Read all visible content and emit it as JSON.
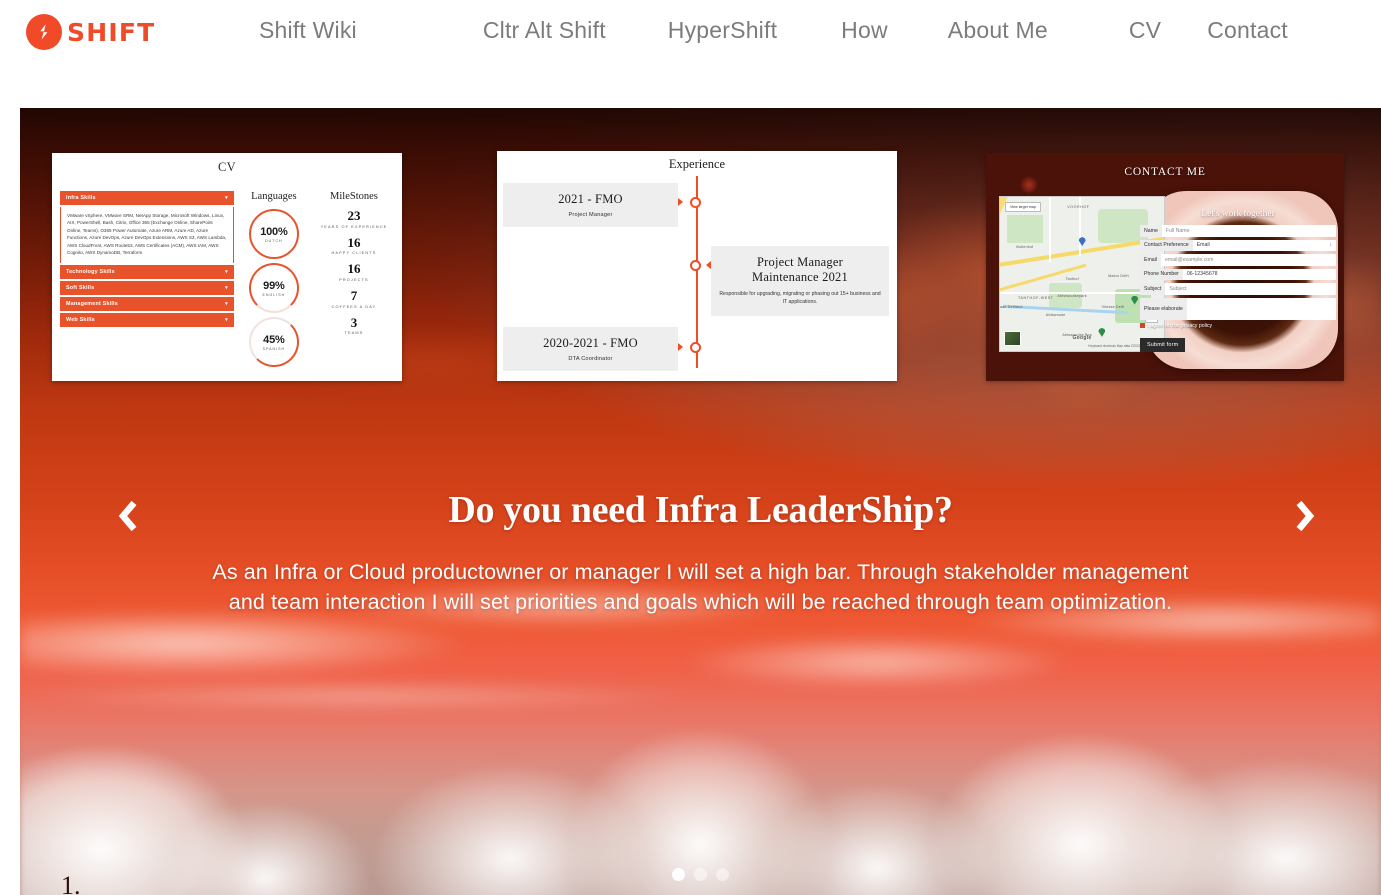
{
  "nav": {
    "logo_text": "SHIFT",
    "logo_icon": "shift-bolt-logo-icon",
    "items": [
      {
        "label": "Shift Wiki"
      },
      {
        "label": "Cltr Alt Shift"
      },
      {
        "label": "HyperShift"
      },
      {
        "label": "How"
      },
      {
        "label": "About Me"
      },
      {
        "label": "CV"
      },
      {
        "label": "Contact"
      }
    ]
  },
  "cards": {
    "cv": {
      "title": "CV",
      "skill_groups": [
        {
          "label": "Infra Skills",
          "expanded": true,
          "body": "VMware vSphere, VMware SRM, NetApp Storage, Microsoft Windows, Linux, AIX, PowerShell, Bash, Citrix, Office 365 (Exchange Online, SharePoint Online, Teams), O365 Power Automate, Azure ARM, Azure AD, Azure Functions, Azure DevOps, Azure DevOps Extensions, AWS S3, AWS Lambda, AWS CloudFront, AWS Route53, AWS Certificates (ACM), AWS IAM, AWS Cognito, AWS DynamoDB, Terraform"
        },
        {
          "label": "Technology Skills",
          "expanded": false,
          "body": ""
        },
        {
          "label": "Soft Skills",
          "expanded": false,
          "body": ""
        },
        {
          "label": "Management Skills",
          "expanded": false,
          "body": ""
        },
        {
          "label": "Web Skills",
          "expanded": false,
          "body": ""
        }
      ],
      "languages_heading": "Languages",
      "languages": [
        {
          "percent": "100%",
          "name": "DUTCH"
        },
        {
          "percent": "99%",
          "name": "ENGLISH"
        },
        {
          "percent": "45%",
          "name": "SPANISH"
        }
      ],
      "milestones_heading": "MileStones",
      "milestones": [
        {
          "value": "23",
          "label": "YEARS OF EXPERIENCE"
        },
        {
          "value": "16",
          "label": "HAPPY CLIENTS"
        },
        {
          "value": "16",
          "label": "PROJECTS"
        },
        {
          "value": "7",
          "label": "COFFEES A DAY"
        },
        {
          "value": "3",
          "label": "TEAMS"
        }
      ]
    },
    "experience": {
      "title": "Experience",
      "entries": [
        {
          "date": "2021 - FMO",
          "role": "Project Manager",
          "desc": "",
          "side": "left"
        },
        {
          "date": "",
          "role": "Project Manager\nMaintenance 2021",
          "title_line1": "Project Manager",
          "title_line2": "Maintenance 2021",
          "desc": "Responsible for upgrading, migrating or phasing out 15+ business and IT applications.",
          "side": "right"
        },
        {
          "date": "2020-2021 - FMO",
          "role": "DTA Coordinator",
          "desc": "",
          "side": "left"
        }
      ]
    },
    "contact": {
      "title": "CONTACT ME",
      "form_title": "Let's work together",
      "map": {
        "view_larger": "View larger map",
        "labels": [
          "VOORHOF",
          "Buitenhof",
          "Tanthof",
          "TANTHOF-WEST",
          "Abtswoudsepark",
          "Abtswoude",
          "Abtswoudse Bos",
          "Makro Delft",
          "Vitesse Delft",
          "aan Delfland"
        ],
        "google": "Google",
        "attribution": "Keyboard shortcuts   Map data ©2022   Terms of Use",
        "zoom_in": "+",
        "zoom_out": "−"
      },
      "fields": [
        {
          "label": "Name",
          "value": "Full Name",
          "filled": false,
          "end": ""
        },
        {
          "label": "Contact Preference",
          "value": "Email",
          "filled": true,
          "end": "↕"
        },
        {
          "label": "Email",
          "value": "email@example.com",
          "filled": false,
          "end": ""
        },
        {
          "label": "Phone Number",
          "value": "06-12345678",
          "filled": true,
          "end": ""
        },
        {
          "label": "Subject",
          "value": "Subject",
          "filled": false,
          "end": ""
        },
        {
          "label": "Please elaborate",
          "value": "",
          "filled": false,
          "end": ""
        }
      ],
      "privacy_label": "I agree on the privacy policy",
      "submit_label": "Submit form"
    }
  },
  "hero": {
    "heading": "Do you need Infra LeaderShip?",
    "paragraph": "As an Infra or Cloud productowner or manager I will set a high bar. Through stakeholder management and team interaction I will set priorities and goals which will be reached through team optimization.",
    "prev_icon": "chevron-left-icon",
    "next_icon": "chevron-right-icon",
    "slide_count": 3,
    "active_slide": 1,
    "page_marker": "1."
  },
  "colors": {
    "brand_orange": "#f04a28",
    "nav_text": "#7c7c7c",
    "hero_text": "#ffffff",
    "accent_red": "#e8532c"
  }
}
